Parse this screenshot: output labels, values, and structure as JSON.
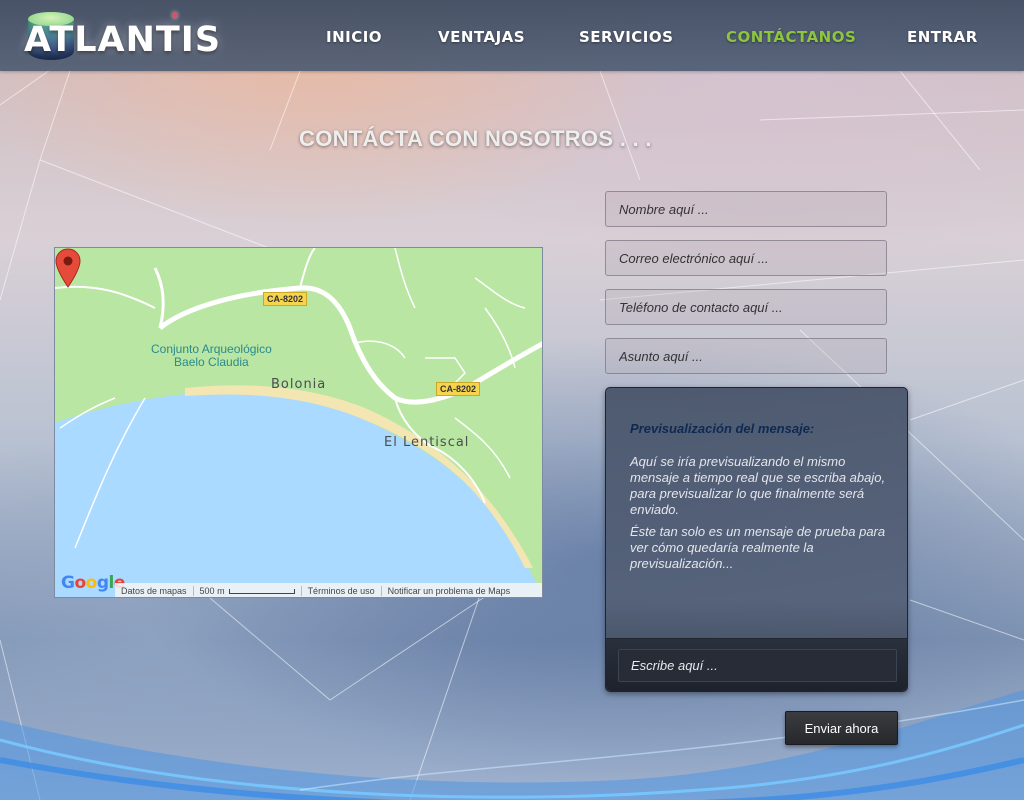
{
  "brand": {
    "name": "ATLANTIS"
  },
  "nav": {
    "items": [
      {
        "label": "INICIO"
      },
      {
        "label": "VENTAJAS"
      },
      {
        "label": "SERVICIOS"
      },
      {
        "label": "CONTÁCTANOS",
        "active": true
      },
      {
        "label": "ENTRAR"
      }
    ],
    "active_color": "#8cc63f"
  },
  "page": {
    "heading": "CONTÁCTA CON NOSOTROS . . ."
  },
  "map": {
    "poi_label_line1": "Conjunto Arqueológico",
    "poi_label_line2": "Baelo Claudia",
    "town_1": "Bolonia",
    "town_2": "El Lentiscal",
    "road_1": "CA-8202",
    "road_2": "CA-8202",
    "pin_icon": "map-pin-icon",
    "footer": {
      "data": "Datos de mapas",
      "scale": "500 m",
      "terms": "Términos de uso",
      "report": "Notificar un problema de Maps"
    }
  },
  "form": {
    "name_placeholder": "Nombre aquí ...",
    "email_placeholder": "Correo electrónico aquí ...",
    "phone_placeholder": "Teléfono de contacto aquí ...",
    "subject_placeholder": "Asunto aquí ...",
    "message_placeholder": "Escribe aquí ...",
    "submit_label": "Enviar ahora"
  },
  "preview": {
    "title": "Previsualización del mensaje:",
    "paragraph_1": "Aquí se iría previsualizando el mismo mensaje a tiempo real que se escriba abajo, para previsualizar lo que finalmente será enviado.",
    "paragraph_2": "Éste tan solo es un mensaje de prueba para ver cómo quedaría realmente la previsualización..."
  }
}
